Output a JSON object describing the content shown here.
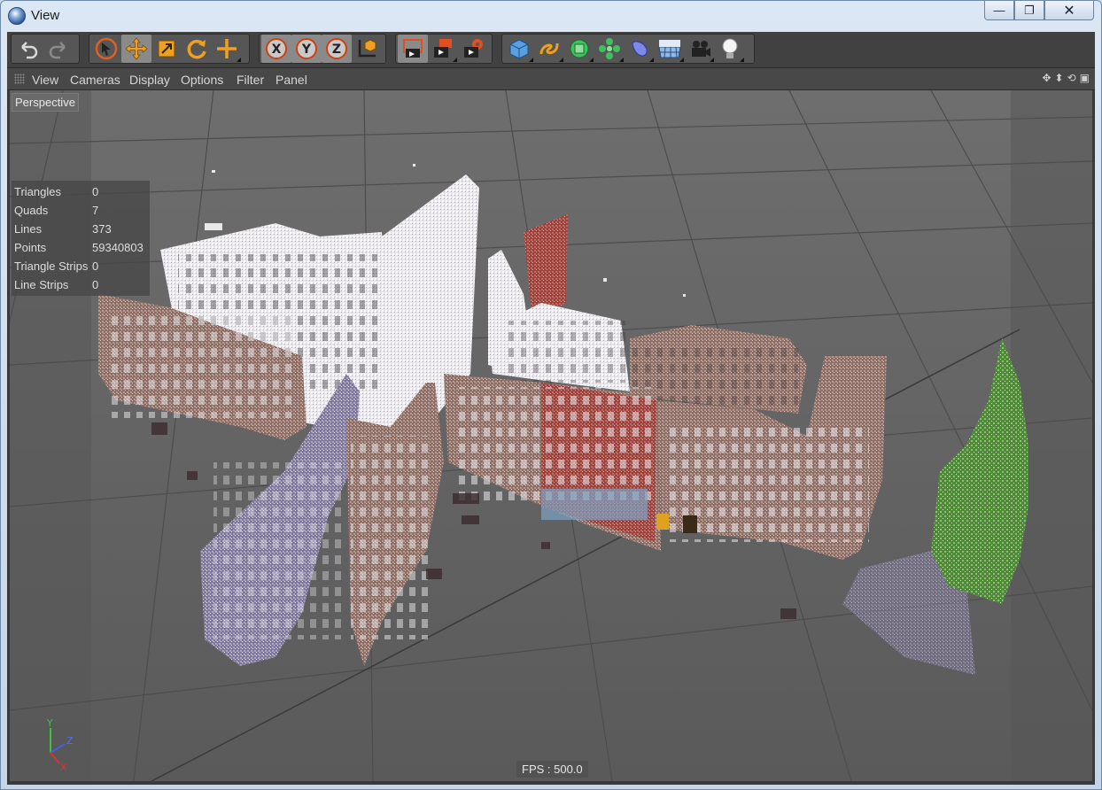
{
  "window": {
    "title": "View",
    "buttons": [
      "—",
      "❐",
      "✕"
    ]
  },
  "toolbar": {
    "groups": [
      {
        "name": "undo-group",
        "items": [
          "undo-icon",
          "redo-icon"
        ]
      },
      {
        "name": "transform-group",
        "items": [
          "live-selection-icon",
          "move-icon",
          "scale-icon",
          "rotate-icon",
          "recent-tool-icon"
        ]
      },
      {
        "name": "axis-group",
        "items": [
          "x-axis-icon",
          "y-axis-icon",
          "z-axis-icon",
          "coordinate-system-icon"
        ]
      },
      {
        "name": "render-group",
        "items": [
          "render-view-icon",
          "render-picture-viewer-icon",
          "render-settings-icon"
        ]
      },
      {
        "name": "objects-group",
        "items": [
          "cube-icon",
          "spline-icon",
          "nurbs-icon",
          "array-icon",
          "deformer-icon",
          "floor-icon",
          "camera-icon",
          "light-icon"
        ]
      }
    ]
  },
  "menu": [
    "View",
    "Cameras",
    "Display",
    "Options",
    "Filter",
    "Panel"
  ],
  "viewport": {
    "label": "Perspective",
    "stats": [
      {
        "key": "Triangles",
        "value": "0"
      },
      {
        "key": "Quads",
        "value": "7"
      },
      {
        "key": "Lines",
        "value": "373"
      },
      {
        "key": "Points",
        "value": "59340803"
      },
      {
        "key": "Triangle Strips",
        "value": "0"
      },
      {
        "key": "Line Strips",
        "value": "0"
      }
    ],
    "fps": "FPS : 500.0",
    "axis": {
      "x": "X",
      "y": "Y",
      "z": "Z"
    }
  },
  "colors": {
    "accent": "#f0a020",
    "viewport_bg": "#5f5f5f",
    "grid": "#4a4a4a"
  }
}
